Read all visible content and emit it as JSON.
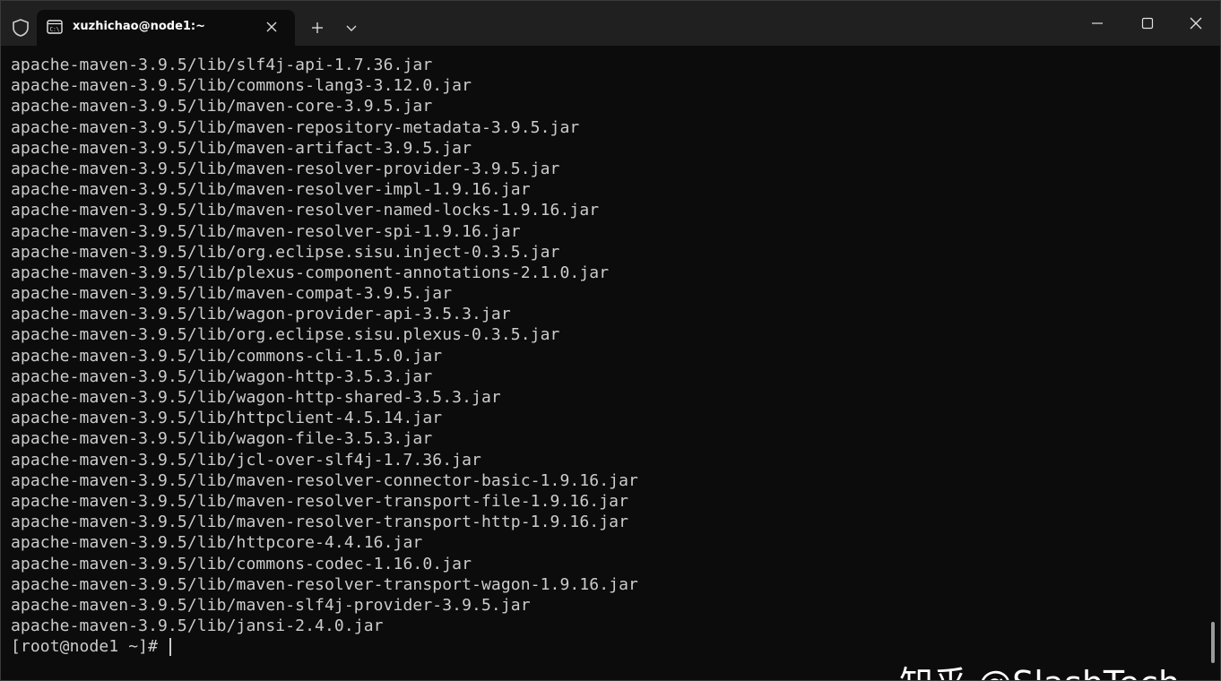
{
  "window": {
    "tab_title": "xuzhichao@node1:~",
    "icons": {
      "shield": "shield-icon",
      "terminal": "terminal-tab-icon",
      "close_tab": "close-icon",
      "new_tab": "plus-icon",
      "dropdown": "chevron-down-icon",
      "minimize": "minimize-icon",
      "maximize": "maximize-icon",
      "close_window": "close-window-icon"
    }
  },
  "terminal": {
    "lines": [
      "apache-maven-3.9.5/lib/slf4j-api-1.7.36.jar",
      "apache-maven-3.9.5/lib/commons-lang3-3.12.0.jar",
      "apache-maven-3.9.5/lib/maven-core-3.9.5.jar",
      "apache-maven-3.9.5/lib/maven-repository-metadata-3.9.5.jar",
      "apache-maven-3.9.5/lib/maven-artifact-3.9.5.jar",
      "apache-maven-3.9.5/lib/maven-resolver-provider-3.9.5.jar",
      "apache-maven-3.9.5/lib/maven-resolver-impl-1.9.16.jar",
      "apache-maven-3.9.5/lib/maven-resolver-named-locks-1.9.16.jar",
      "apache-maven-3.9.5/lib/maven-resolver-spi-1.9.16.jar",
      "apache-maven-3.9.5/lib/org.eclipse.sisu.inject-0.3.5.jar",
      "apache-maven-3.9.5/lib/plexus-component-annotations-2.1.0.jar",
      "apache-maven-3.9.5/lib/maven-compat-3.9.5.jar",
      "apache-maven-3.9.5/lib/wagon-provider-api-3.5.3.jar",
      "apache-maven-3.9.5/lib/org.eclipse.sisu.plexus-0.3.5.jar",
      "apache-maven-3.9.5/lib/commons-cli-1.5.0.jar",
      "apache-maven-3.9.5/lib/wagon-http-3.5.3.jar",
      "apache-maven-3.9.5/lib/wagon-http-shared-3.5.3.jar",
      "apache-maven-3.9.5/lib/httpclient-4.5.14.jar",
      "apache-maven-3.9.5/lib/wagon-file-3.5.3.jar",
      "apache-maven-3.9.5/lib/jcl-over-slf4j-1.7.36.jar",
      "apache-maven-3.9.5/lib/maven-resolver-connector-basic-1.9.16.jar",
      "apache-maven-3.9.5/lib/maven-resolver-transport-file-1.9.16.jar",
      "apache-maven-3.9.5/lib/maven-resolver-transport-http-1.9.16.jar",
      "apache-maven-3.9.5/lib/httpcore-4.4.16.jar",
      "apache-maven-3.9.5/lib/commons-codec-1.16.0.jar",
      "apache-maven-3.9.5/lib/maven-resolver-transport-wagon-1.9.16.jar",
      "apache-maven-3.9.5/lib/maven-slf4j-provider-3.9.5.jar",
      "apache-maven-3.9.5/lib/jansi-2.4.0.jar"
    ],
    "prompt": "[root@node1 ~]# "
  },
  "watermark": "知乎 @SlashTech",
  "colors": {
    "background": "#0c0c0c",
    "titlebar": "#202020",
    "text": "#cccccc"
  }
}
